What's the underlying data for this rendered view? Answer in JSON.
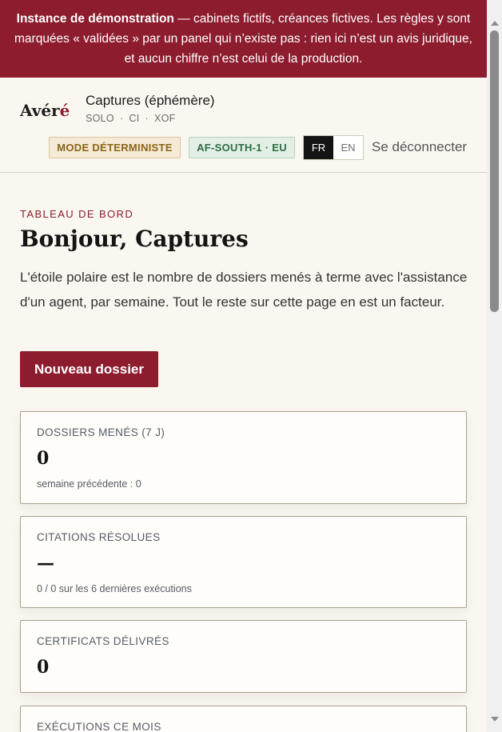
{
  "banner": {
    "strong": "Instance de démonstration",
    "text": " — cabinets fictifs, créances fictives. Les règles y sont marquées « validées » par un panel qui n’existe pas : rien ici n’est un avis juridique, et aucun chiffre n’est celui de la production."
  },
  "header": {
    "logo_main": "Avér",
    "logo_accent": "é",
    "workspace_name": "Captures (éphémère)",
    "meta": [
      "SOLO",
      "CI",
      "XOF"
    ],
    "mode_badge": "MODE DÉTERMINISTE",
    "region_badge": "AF-SOUTH-1 · EU",
    "lang_active": "FR",
    "lang_other": "EN",
    "logout": "Se déconnecter"
  },
  "main": {
    "eyebrow": "TABLEAU DE BORD",
    "title": "Bonjour, Captures",
    "intro": "L'étoile polaire est le nombre de dossiers menés à terme avec l'assistance d'un agent, par semaine. Tout le reste sur cette page en est un facteur.",
    "new_case_button": "Nouveau dossier"
  },
  "cards": [
    {
      "label": "DOSSIERS MENÉS (7 J)",
      "value": "0",
      "sub": "semaine précédente : 0"
    },
    {
      "label": "CITATIONS RÉSOLUES",
      "value": "—",
      "sub": "0 / 0 sur les 6 dernières exécutions"
    },
    {
      "label": "CERTIFICATS DÉLIVRÉS",
      "value": "0",
      "sub": ""
    },
    {
      "label": "EXÉCUTIONS CE MOIS",
      "value": "",
      "sub": ""
    }
  ],
  "colors": {
    "brand": "#8c1c2e",
    "background": "#faf7f0"
  }
}
